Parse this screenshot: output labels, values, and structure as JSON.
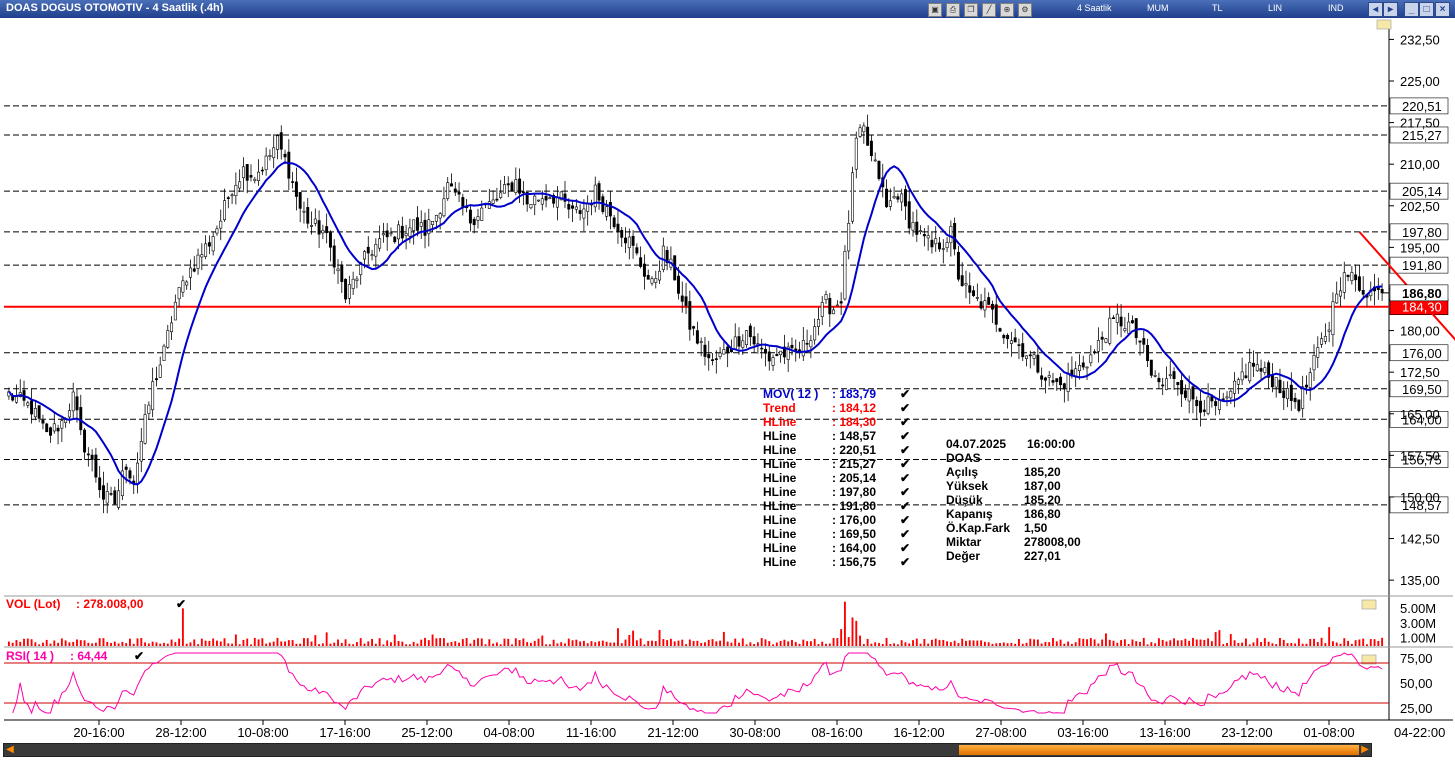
{
  "window": {
    "title": "DOAS DOGUS OTOMOTIV - 4 Saatlik (.4h)",
    "toolbar": {
      "period_label": "4 Saatlik",
      "chart_style_label": "MUM",
      "currency_label": "TL",
      "scale_label": "LIN",
      "indicator_label": "IND"
    }
  },
  "chart_data": {
    "type": "candlestick",
    "symbol": "DOAS",
    "x_tick_labels": [
      "20-16:00",
      "28-12:00",
      "10-08:00",
      "17-16:00",
      "25-12:00",
      "04-08:00",
      "11-16:00",
      "21-12:00",
      "30-08:00",
      "08-16:00",
      "16-12:00",
      "27-08:00",
      "03-16:00",
      "13-16:00",
      "23-12:00",
      "01-08:00",
      "04-22:00"
    ],
    "y_ticks": [
      135.0,
      142.5,
      150.0,
      157.5,
      165.0,
      172.5,
      180.0,
      187.5,
      195.0,
      202.5,
      210.0,
      217.5,
      225.0,
      232.5
    ],
    "y_tick_labels": [
      "135,00",
      "142,50",
      "150,00",
      "157,50",
      "165,00",
      "172,50",
      "180,00",
      "187,50",
      "195,00",
      "202,50",
      "210,00",
      "217,50",
      "225,00",
      "232,50"
    ],
    "ylim": [
      132.5,
      236.0
    ],
    "price_path": [
      [
        0,
        168.5
      ],
      [
        6,
        166.0
      ],
      [
        10,
        161.0
      ],
      [
        14,
        163.5
      ],
      [
        17,
        168.0
      ],
      [
        19,
        161.0
      ],
      [
        22,
        156.0
      ],
      [
        25,
        150.0
      ],
      [
        28,
        149.0
      ],
      [
        31,
        156.0
      ],
      [
        33,
        153.0
      ],
      [
        35,
        160.0
      ],
      [
        38,
        170.0
      ],
      [
        41,
        176.0
      ],
      [
        44,
        185.0
      ],
      [
        47,
        190.0
      ],
      [
        50,
        193.0
      ],
      [
        53,
        196.0
      ],
      [
        56,
        200.0
      ],
      [
        59,
        206.0
      ],
      [
        62,
        209.0
      ],
      [
        65,
        208.0
      ],
      [
        68,
        210.5
      ],
      [
        71,
        214.0
      ],
      [
        74,
        209.0
      ],
      [
        77,
        202.0
      ],
      [
        80,
        199.0
      ],
      [
        83,
        198.0
      ],
      [
        86,
        193.0
      ],
      [
        89,
        186.0
      ],
      [
        92,
        190.0
      ],
      [
        95,
        194.0
      ],
      [
        98,
        196.0
      ],
      [
        101,
        197.0
      ],
      [
        104,
        198.0
      ],
      [
        107,
        199.0
      ],
      [
        110,
        198.0
      ],
      [
        113,
        201.0
      ],
      [
        116,
        206.0
      ],
      [
        119,
        203.0
      ],
      [
        122,
        200.0
      ],
      [
        125,
        202.0
      ],
      [
        128,
        203.0
      ],
      [
        131,
        205.0
      ],
      [
        134,
        207.0
      ],
      [
        137,
        203.0
      ],
      [
        140,
        204.0
      ],
      [
        143,
        204.5
      ],
      [
        146,
        203.5
      ],
      [
        149,
        201.0
      ],
      [
        152,
        202.0
      ],
      [
        155,
        205.0
      ],
      [
        158,
        202.0
      ],
      [
        161,
        199.0
      ],
      [
        164,
        196.0
      ],
      [
        167,
        192.0
      ],
      [
        170,
        188.0
      ],
      [
        173,
        194.0
      ],
      [
        176,
        190.0
      ],
      [
        178,
        185.0
      ],
      [
        180,
        181.0
      ],
      [
        183,
        177.0
      ],
      [
        186,
        174.0
      ],
      [
        189,
        176.0
      ],
      [
        192,
        178.0
      ],
      [
        195,
        180.0
      ],
      [
        198,
        177.0
      ],
      [
        201,
        175.0
      ],
      [
        204,
        176.0
      ],
      [
        207,
        175.5
      ],
      [
        210,
        177.0
      ],
      [
        213,
        181.0
      ],
      [
        216,
        185.0
      ],
      [
        218,
        184.0
      ],
      [
        220,
        186.0
      ],
      [
        222,
        200.0
      ],
      [
        224,
        214.0
      ],
      [
        226,
        216.0
      ],
      [
        228,
        211.0
      ],
      [
        230,
        208.0
      ],
      [
        232,
        202.0
      ],
      [
        235,
        205.0
      ],
      [
        238,
        200.0
      ],
      [
        241,
        197.0
      ],
      [
        244,
        195.0
      ],
      [
        247,
        196.0
      ],
      [
        249,
        197.5
      ],
      [
        251,
        190.0
      ],
      [
        254,
        186.0
      ],
      [
        257,
        185.0
      ],
      [
        260,
        183.0
      ],
      [
        263,
        180.0
      ],
      [
        266,
        178.0
      ],
      [
        269,
        176.0
      ],
      [
        272,
        173.5
      ],
      [
        275,
        171.0
      ],
      [
        278,
        170.0
      ],
      [
        281,
        172.0
      ],
      [
        284,
        174.0
      ],
      [
        287,
        176.0
      ],
      [
        290,
        180.0
      ],
      [
        293,
        182.0
      ],
      [
        296,
        181.0
      ],
      [
        299,
        178.0
      ],
      [
        302,
        172.0
      ],
      [
        305,
        170.0
      ],
      [
        308,
        172.0
      ],
      [
        311,
        169.0
      ],
      [
        314,
        167.0
      ],
      [
        317,
        166.5
      ],
      [
        320,
        166.0
      ],
      [
        323,
        168.0
      ],
      [
        326,
        172.0
      ],
      [
        329,
        174.0
      ],
      [
        332,
        172.0
      ],
      [
        335,
        171.0
      ],
      [
        338,
        168.0
      ],
      [
        341,
        167.0
      ],
      [
        343,
        170.0
      ],
      [
        346,
        176.0
      ],
      [
        349,
        181.0
      ],
      [
        351,
        188.0
      ],
      [
        354,
        190.0
      ],
      [
        357,
        188.0
      ],
      [
        360,
        187.0
      ],
      [
        363,
        186.8
      ]
    ],
    "bars": 364,
    "series": [
      {
        "name": "MOV( 12 )",
        "last_value_label": ": 183,79",
        "color": "#0000cc"
      }
    ],
    "trend_line": {
      "name": "Trend",
      "value_label": ": 184,12",
      "color": "#ff0000",
      "from": [
        357,
        197.8
      ],
      "to": [
        390,
        172.5
      ]
    },
    "hlines": [
      {
        "value": 184.3,
        "label": "184,30",
        "legend_value": ": 184,30",
        "highlight": true
      },
      {
        "value": 148.57,
        "label": "148,57",
        "legend_value": ": 148,57"
      },
      {
        "value": 220.51,
        "label": "220,51",
        "legend_value": ": 220,51"
      },
      {
        "value": 215.27,
        "label": "215,27",
        "legend_value": ": 215,27"
      },
      {
        "value": 205.14,
        "label": "205,14",
        "legend_value": ": 205,14"
      },
      {
        "value": 197.8,
        "label": "197,80",
        "legend_value": ": 197,80"
      },
      {
        "value": 191.8,
        "label": "191,80",
        "legend_value": ": 191,80"
      },
      {
        "value": 176.0,
        "label": "176,00",
        "legend_value": ": 176,00"
      },
      {
        "value": 169.5,
        "label": "169,50",
        "legend_value": ": 169,50"
      },
      {
        "value": 164.0,
        "label": "164,00",
        "legend_value": ": 164,00"
      },
      {
        "value": 156.75,
        "label": "156,75",
        "legend_value": ": 156,75"
      }
    ],
    "last_price": {
      "value": 186.8,
      "label": "186,80"
    },
    "volume": {
      "label": "VOL (Lot)",
      "value_label": ": 278.008,00",
      "y_tick_labels": [
        "5.00M",
        "3.00M",
        "1.00M"
      ],
      "y_ticks": [
        5.0,
        3.0,
        1.0
      ],
      "max": 6.5
    },
    "rsi": {
      "label": "RSI( 14 )",
      "value_label": ": 64,44",
      "y_ticks": [
        75,
        50,
        25
      ],
      "y_tick_labels": [
        "75,00",
        "50,00",
        "25,00"
      ],
      "upper": 70,
      "lower": 30,
      "ylim": [
        15,
        85
      ],
      "color": "#ff00aa"
    },
    "grid": false
  },
  "legend": {
    "hline_name": "HLine"
  },
  "info_panel": {
    "date": "04.07.2025",
    "time": "16:00:00",
    "symbol": "DOAS",
    "rows": [
      {
        "label": "Açılış",
        "value": "185,20"
      },
      {
        "label": "Yüksek",
        "value": "187,00"
      },
      {
        "label": "Düşük",
        "value": "185,20"
      },
      {
        "label": "Kapanış",
        "value": "186,80"
      },
      {
        "label": "Ö.Kap.Fark",
        "value": "1,50"
      },
      {
        "label": "Miktar",
        "value": "278008,00"
      },
      {
        "label": "Değer",
        "value": "227,01"
      }
    ]
  },
  "colors": {
    "up": "#ffffff",
    "down": "#000000",
    "hline": "#000000",
    "highlight": "#ff0000",
    "title_bar": "#1f3f8c"
  }
}
